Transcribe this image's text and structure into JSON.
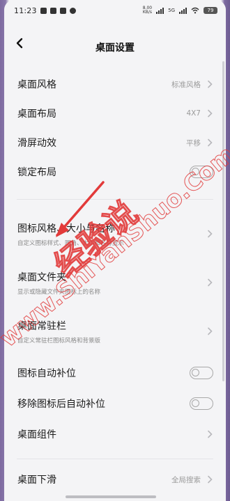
{
  "status_bar": {
    "time": "11:23",
    "net_speed": "8.00\nKB/s",
    "net_type": "5G",
    "battery": "79"
  },
  "header": {
    "title": "桌面设置"
  },
  "rows": [
    {
      "title": "桌面风格",
      "value": "标准风格"
    },
    {
      "title": "桌面布局",
      "value": "4X7"
    },
    {
      "title": "滑屏动效",
      "value": "平移"
    },
    {
      "title": "锁定布局"
    },
    {
      "title": "图标风格、大小与名称",
      "subtitle": "自定义图标样式、圆角、大小和名称显示"
    },
    {
      "title": "桌面文件夹",
      "subtitle": "显示或隐藏文件夹图标上的名称"
    },
    {
      "title": "桌面常驻栏",
      "subtitle": "自定义常驻栏图标风格和背景版"
    },
    {
      "title": "图标自动补位"
    },
    {
      "title": "移除图标后自动补位"
    },
    {
      "title": "桌面组件"
    },
    {
      "title": "桌面下滑",
      "value": "全局搜索"
    }
  ],
  "toggles": {
    "lock_layout": false,
    "auto_fill": false,
    "auto_fill_after_remove": false
  },
  "watermark": {
    "text": "经验说",
    "url": "www.ShiYanShuo.Com"
  },
  "colors": {
    "background": "#f4f4f6",
    "watermark": "#e23a3a",
    "frame": "#7d6aa0"
  }
}
